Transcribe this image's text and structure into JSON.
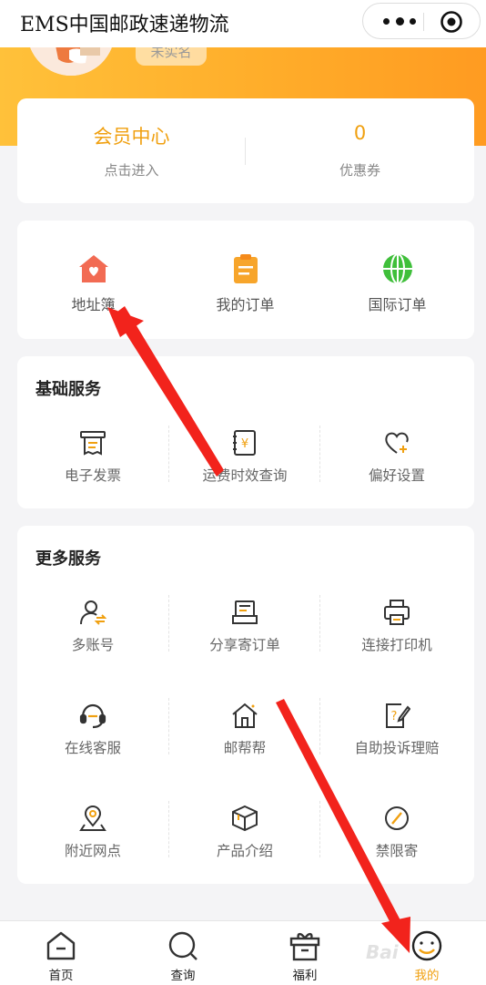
{
  "titlebar": {
    "title": "EMS中国邮政速递物流"
  },
  "profile": {
    "badge": "未实名"
  },
  "member": {
    "center_label": "会员中心",
    "center_sub": "点击进入",
    "coupon_count": "0",
    "coupon_label": "优惠券"
  },
  "quick": [
    {
      "label": "地址簿",
      "icon": "address-book-icon",
      "color": "#f26b53"
    },
    {
      "label": "我的订单",
      "icon": "orders-icon",
      "color": "#f7a52b"
    },
    {
      "label": "国际订单",
      "icon": "globe-icon",
      "color": "#3fbf3a"
    }
  ],
  "basic": {
    "title": "基础服务",
    "items": [
      {
        "label": "电子发票",
        "icon": "receipt-icon"
      },
      {
        "label": "运费时效查询",
        "icon": "freight-query-icon"
      },
      {
        "label": "偏好设置",
        "icon": "heart-plus-icon"
      }
    ]
  },
  "more": {
    "title": "更多服务",
    "items": [
      {
        "label": "多账号",
        "icon": "multi-account-icon"
      },
      {
        "label": "分享寄订单",
        "icon": "share-order-icon"
      },
      {
        "label": "连接打印机",
        "icon": "printer-icon"
      },
      {
        "label": "在线客服",
        "icon": "headset-icon"
      },
      {
        "label": "邮帮帮",
        "icon": "house-icon"
      },
      {
        "label": "自助投诉理赔",
        "icon": "complaint-icon"
      },
      {
        "label": "附近网点",
        "icon": "location-icon"
      },
      {
        "label": "产品介绍",
        "icon": "box-icon"
      },
      {
        "label": "禁限寄",
        "icon": "forbidden-icon"
      }
    ]
  },
  "tabs": [
    {
      "label": "首页",
      "icon": "home-tab-icon"
    },
    {
      "label": "查询",
      "icon": "search-tab-icon"
    },
    {
      "label": "福利",
      "icon": "gift-tab-icon"
    },
    {
      "label": "我的",
      "icon": "profile-tab-icon",
      "active": true
    }
  ],
  "watermark": "Bai",
  "colors": {
    "accent": "#f0a010",
    "hero_start": "#ffc13a",
    "hero_end": "#ff9b21",
    "arrow": "#f2231c"
  }
}
